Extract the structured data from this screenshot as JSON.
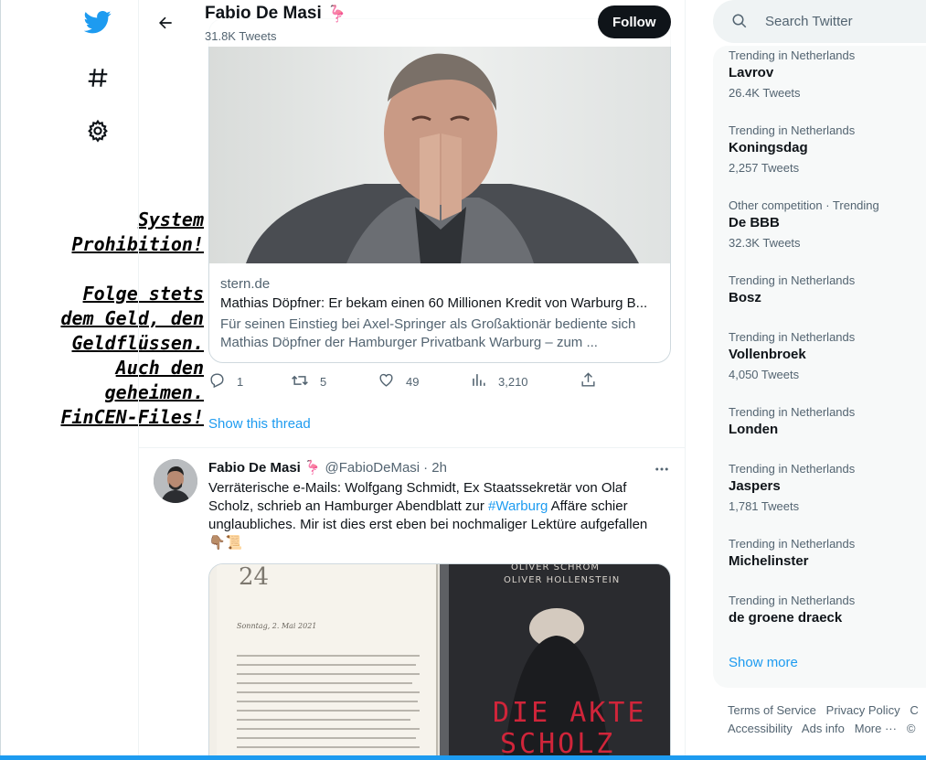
{
  "nav": {
    "logo_icon": "twitter-bird-icon",
    "explore_icon": "hashtag-icon",
    "settings_icon": "gear-icon",
    "accent": "#1d9bf0"
  },
  "overlay": {
    "line1": "System",
    "line2": "Prohibition!",
    "line3": "Folge stets",
    "line4": "dem Geld, den",
    "line5": "Geldflüssen.",
    "line6": "Auch den",
    "line7": "geheimen.",
    "line8": "FinCEN-Files!"
  },
  "header": {
    "name": "Fabio De Masi",
    "emoji": "🦩",
    "tweets": "31.8K Tweets",
    "follow_label": "Follow"
  },
  "card": {
    "domain": "stern.de",
    "title": "Mathias Döpfner: Er bekam einen 60 Millionen Kredit von Warburg B...",
    "description": "Für seinen Einstieg bei Axel-Springer als Großaktionär bediente sich Mathias Döpfner der Hamburger Privatbank Warburg – zum ..."
  },
  "actions": {
    "replies": "1",
    "retweets": "5",
    "likes": "49",
    "views": "3,210"
  },
  "show_thread": "Show this thread",
  "tweet": {
    "name": "Fabio De Masi",
    "emoji": "🦩",
    "handle": "@FabioDeMasi",
    "time": "· 2h",
    "text_before": "Verräterische e-Mails: Wolfgang Schmidt, Ex Staatssekretär von Olaf Scholz, schrieb an Hamburger Abendblatt zur ",
    "hashtag": "#Warburg",
    "text_after": " Affäre schier unglaubliches. Mir ist dies erst eben bei nochmaliger Lektüre aufgefallen",
    "emojis": "👇🏽📜"
  },
  "media": {
    "page_number": "24",
    "page_heading": "Sonntag, 2. Mai 2021",
    "book_authors_1": "OLIVER SCHRÖM",
    "book_authors_2": "OLIVER HOLLENSTEIN",
    "book_title_1": "DIE AKTE",
    "book_title_2": "SCHOLZ"
  },
  "search": {
    "placeholder": "Search Twitter"
  },
  "trends": [
    {
      "context": "Trending in Netherlands",
      "name": "Lavrov",
      "count": "26.4K Tweets"
    },
    {
      "context": "Trending in Netherlands",
      "name": "Koningsdag",
      "count": "2,257 Tweets"
    },
    {
      "context": "Other competition · Trending",
      "name": "De BBB",
      "count": "32.3K Tweets"
    },
    {
      "context": "Trending in Netherlands",
      "name": "Bosz",
      "count": ""
    },
    {
      "context": "Trending in Netherlands",
      "name": "Vollenbroek",
      "count": "4,050 Tweets"
    },
    {
      "context": "Trending in Netherlands",
      "name": "Londen",
      "count": ""
    },
    {
      "context": "Trending in Netherlands",
      "name": "Jaspers",
      "count": "1,781 Tweets"
    },
    {
      "context": "Trending in Netherlands",
      "name": "Michelinster",
      "count": ""
    },
    {
      "context": "Trending in Netherlands",
      "name": "de groene draeck",
      "count": ""
    }
  ],
  "show_more": "Show more",
  "footer": {
    "terms": "Terms of Service",
    "privacy": "Privacy Policy",
    "cookie": "C",
    "accessibility": "Accessibility",
    "ads": "Ads info",
    "more": "More ···",
    "copyright": "©"
  }
}
